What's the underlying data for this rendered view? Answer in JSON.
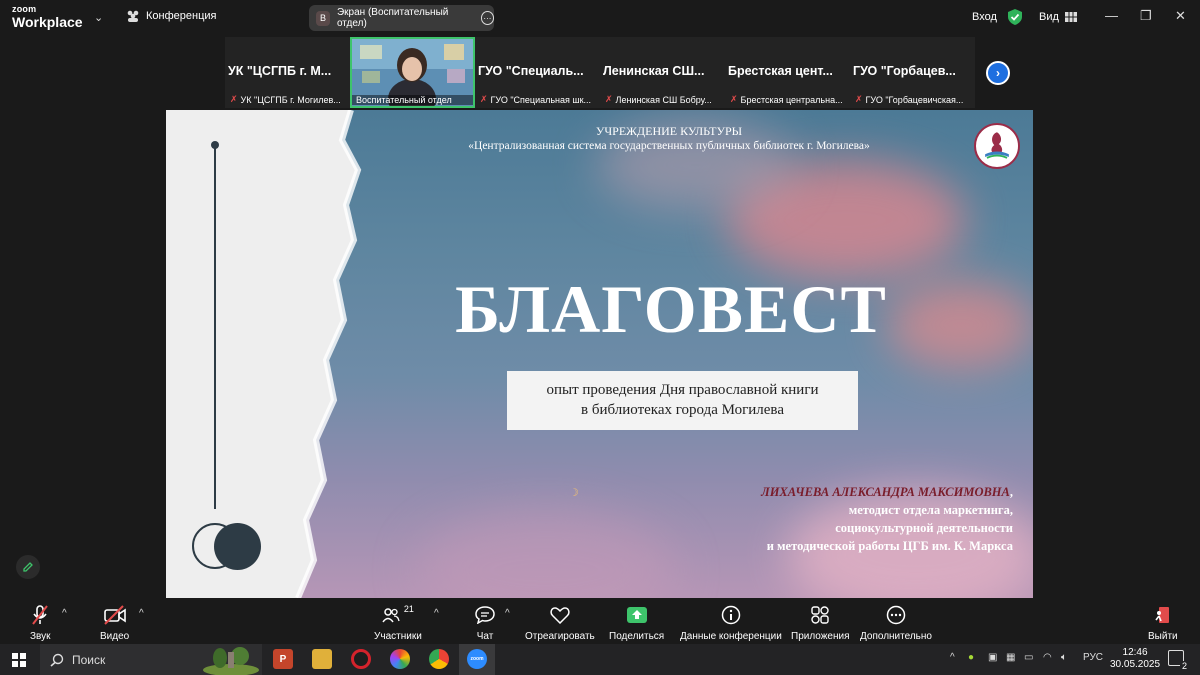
{
  "app": {
    "logo_line1": "zoom",
    "logo_line2": "Workplace"
  },
  "topbar": {
    "conference_label": "Конференция",
    "screen_avatar": "В",
    "screen_label": "Экран (Воспитательный отдел)",
    "login_label": "Вход",
    "view_label": "Вид"
  },
  "thumbnails": [
    {
      "name": "УК \"ЦСГПБ г. М...",
      "caption": "УК \"ЦСГПБ г. Могилев..."
    },
    {
      "name": "",
      "caption": "Воспитательный отдел"
    },
    {
      "name": "ГУО \"Специаль...",
      "caption": "ГУО \"Специальная шк..."
    },
    {
      "name": "Ленинская СШ...",
      "caption": "Ленинская СШ Бобру..."
    },
    {
      "name": "Брестская цент...",
      "caption": "Брестская центральна..."
    },
    {
      "name": "ГУО \"Горбацев...",
      "caption": "ГУО \"Горбацевичская..."
    }
  ],
  "slide": {
    "org_line1": "УЧРЕЖДЕНИЕ КУЛЬТУРЫ",
    "org_line2": "«Централизованная система государственных публичных библиотек г. Могилева»",
    "title": "БЛАГОВЕСТ",
    "subtitle_line1": "опыт проведения Дня православной книги",
    "subtitle_line2": "в библиотеках города Могилева",
    "author_name": "ЛИХАЧЕВА АЛЕКСАНДРА МАКСИМОВНА",
    "author_line2": "методист отдела маркетинга,",
    "author_line3": "социокультурной деятельности",
    "author_line4": "и методической работы ЦГБ им. К. Маркса"
  },
  "toolbar": {
    "audio": "Звук",
    "video": "Видео",
    "participants": "Участники",
    "participants_count": "21",
    "chat": "Чат",
    "react": "Отреагировать",
    "share": "Поделиться",
    "info": "Данные конференции",
    "apps": "Приложения",
    "more": "Дополнительно",
    "leave": "Выйти"
  },
  "taskbar": {
    "search_label": "Поиск",
    "lang": "РУС",
    "time": "12:46",
    "date": "30.05.2025",
    "notifications": "2"
  },
  "colors": {
    "accent": "#1e6fe0",
    "share_green": "#3ec46b",
    "muted_red": "#e24b4b",
    "author_red": "#7a1d2b"
  }
}
